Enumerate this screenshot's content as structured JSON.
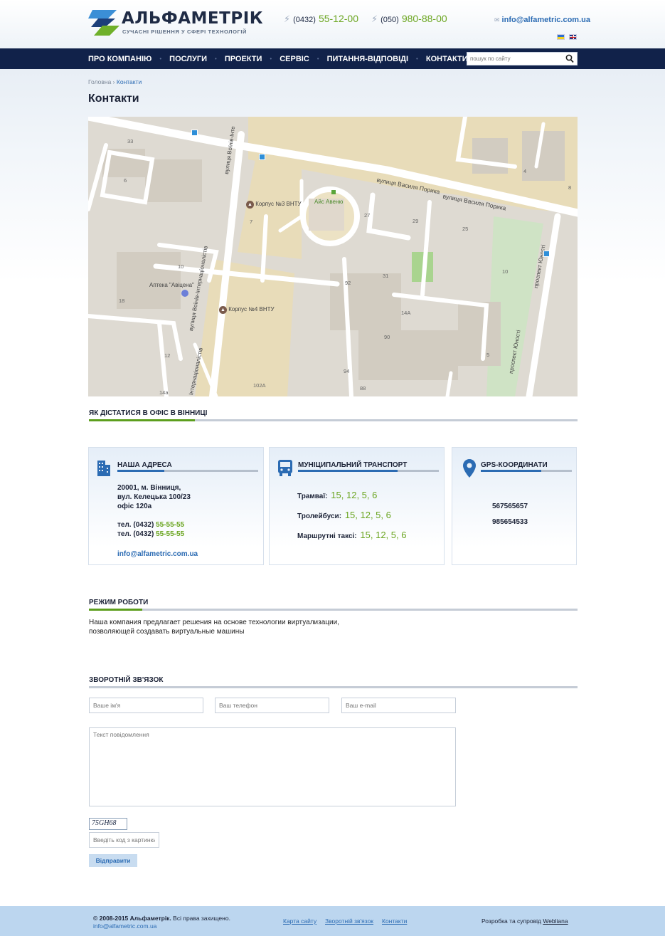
{
  "header": {
    "logo_title": "АЛЬФАМЕТРІК",
    "logo_subtitle": "СУЧАСНІ РІШЕННЯ У СФЕРІ ТЕХНОЛОГІЙ",
    "phones": [
      {
        "code": "(0432)",
        "number": "55-12-00"
      },
      {
        "code": "(050)",
        "number": "980-88-00"
      }
    ],
    "email": "info@alfametric.com.ua",
    "colors": {
      "accent_green": "#6aa51f",
      "brand_navy": "#11224a",
      "link_blue": "#2b6bb3"
    }
  },
  "nav": {
    "items": [
      "ПРО КОМПАНІЮ",
      "ПОСЛУГИ",
      "ПРОЕКТИ",
      "СЕРВІС",
      "ПИТАННЯ-ВІДПОВІДІ",
      "КОНТАКТИ"
    ],
    "search_placeholder": "пошук по сайту"
  },
  "breadcrumb": {
    "home": "Головна",
    "sep": "›",
    "current": "Контакти"
  },
  "page_title": "Контакти",
  "map": {
    "streets": [
      "вулиця Василя Порика",
      "вулиця Василя Порика",
      "вулиця Воїнів-Інте",
      "вулиця Воїнів-Інтернаціоналістів",
      "Інтернаціоналістів",
      "проспект Юності",
      "проспект Юності"
    ],
    "places": [
      "Корпус №3 ВНТУ",
      "Корпус №4 ВНТУ",
      "Айс Авеню",
      "Аптека \"Авіцена\""
    ],
    "numbers": [
      "33",
      "6",
      "7",
      "10",
      "18",
      "12",
      "14a",
      "27",
      "29",
      "25",
      "31",
      "92",
      "90",
      "94",
      "88",
      "14А",
      "10",
      "5",
      "4",
      "8",
      "102А"
    ]
  },
  "directions": {
    "title": "ЯК ДІСТАТИСЯ В ОФІС В ВІННИЦІ"
  },
  "address_box": {
    "title": "НАША АДРЕСА",
    "line1": "20001, м. Вінниця,",
    "line2": "вул. Келецька 100/23",
    "line3": "офіс 120а",
    "tel_label": "тел. (0432)",
    "tel1": "55-55-55",
    "tel2": "55-55-55",
    "email": "info@alfametric.com.ua"
  },
  "transport_box": {
    "title": "МУНІЦИПАЛЬНИЙ ТРАНСПОРТ",
    "rows": [
      {
        "label": "Трамваї:",
        "value": "15, 12, 5, 6"
      },
      {
        "label": "Тролейбуси:",
        "value": "15, 12, 5, 6"
      },
      {
        "label": "Маршрутні таксі:",
        "value": "15, 12, 5, 6"
      }
    ]
  },
  "gps_box": {
    "title": "GPS-КООРДИНАТИ",
    "lat": "567565657",
    "lon": "985654533"
  },
  "work_mode": {
    "title": "РЕЖИМ РОБОТИ",
    "line1": "Наша компания предлагает решения на основе технологии виртуализации,",
    "line2": "позволяющей создавать виртуальные машины"
  },
  "feedback": {
    "title": "ЗВОРОТНІЙ ЗВ'ЯЗОК",
    "name_placeholder": "Ваше ім'я",
    "phone_placeholder": "Ваш телефон",
    "email_placeholder": "Ваш e-mail",
    "message_placeholder": "Текст повідомлення",
    "captcha_code": "75GH68",
    "captcha_placeholder": "Введіть код з картинки",
    "submit_label": "Відправити"
  },
  "footer": {
    "copyright_bold": "© 2008-2015 Альфаметрік.",
    "copyright_rest": " Всі права захищено.",
    "email": "info@alfametric.com.ua",
    "links": [
      "Карта сайту",
      "Зворотній зв'язок",
      "Контакти"
    ],
    "dev_text": "Розробка та супровід",
    "dev_link": "Webliana"
  }
}
